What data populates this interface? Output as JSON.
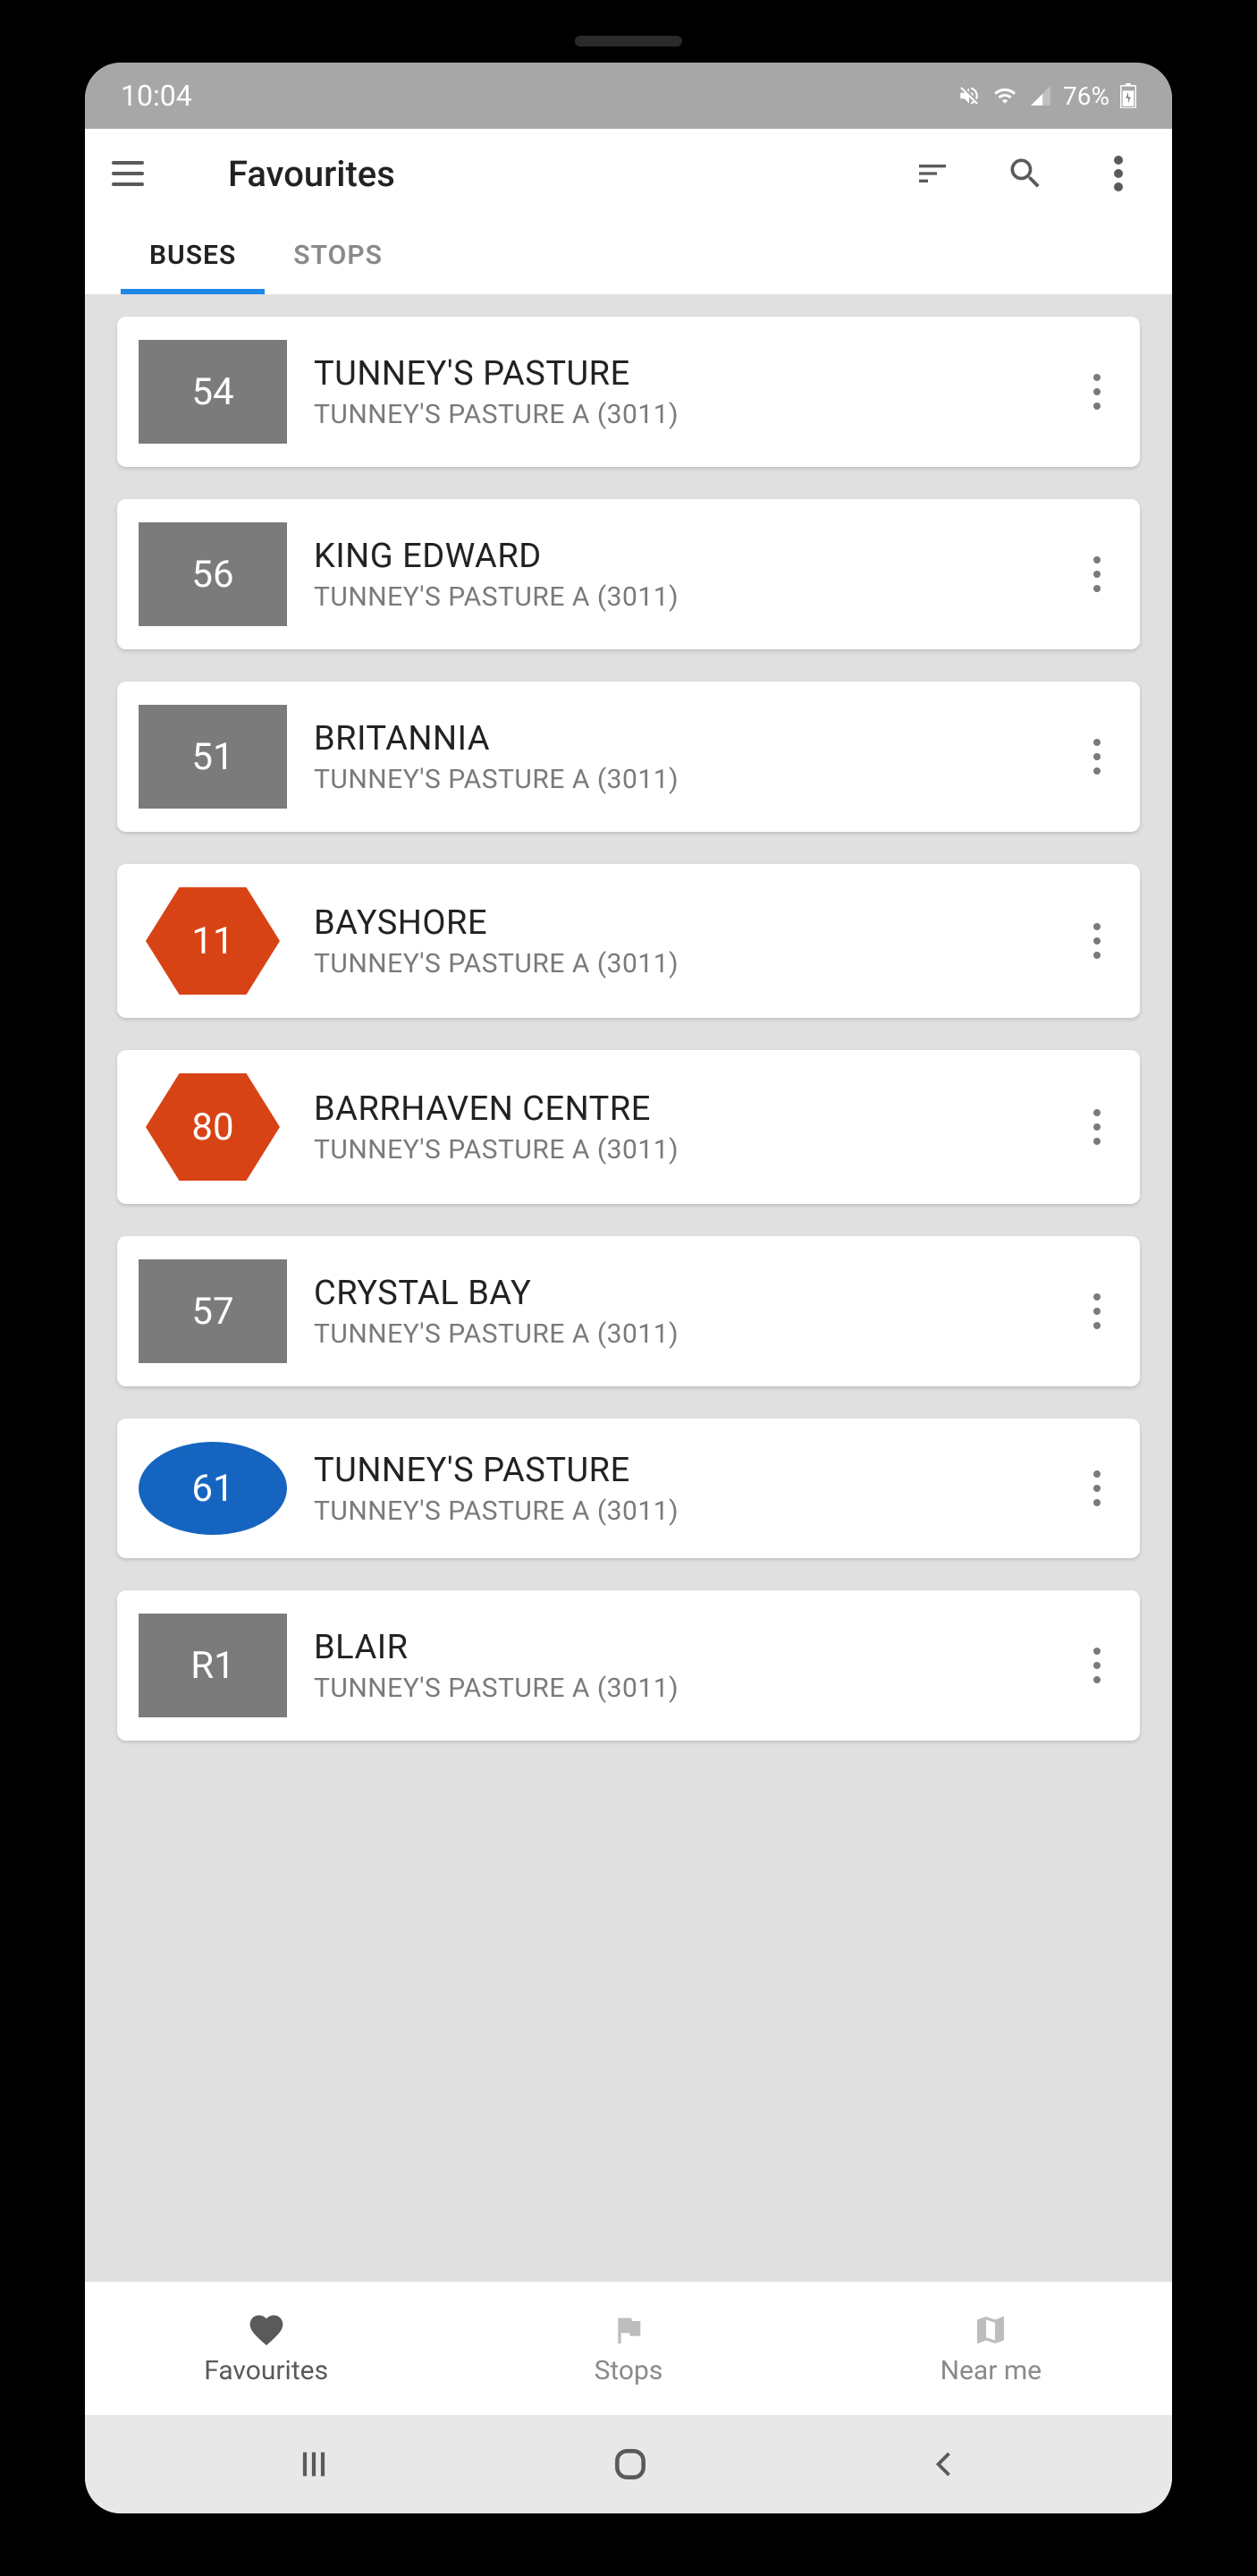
{
  "status_bar": {
    "time": "10:04",
    "battery": "76%"
  },
  "app_bar": {
    "title": "Favourites"
  },
  "tabs": {
    "buses": "BUSES",
    "stops": "STOPS"
  },
  "routes": [
    {
      "number": "54",
      "shape": "rect",
      "title": "TUNNEY'S PASTURE",
      "subtitle": "TUNNEY'S PASTURE A (3011)"
    },
    {
      "number": "56",
      "shape": "rect",
      "title": "KING EDWARD",
      "subtitle": "TUNNEY'S PASTURE A (3011)"
    },
    {
      "number": "51",
      "shape": "rect",
      "title": "BRITANNIA",
      "subtitle": "TUNNEY'S PASTURE A (3011)"
    },
    {
      "number": "11",
      "shape": "hex",
      "title": "BAYSHORE",
      "subtitle": "TUNNEY'S PASTURE A (3011)"
    },
    {
      "number": "80",
      "shape": "hex",
      "title": "BARRHAVEN CENTRE",
      "subtitle": "TUNNEY'S PASTURE A (3011)"
    },
    {
      "number": "57",
      "shape": "rect",
      "title": "CRYSTAL BAY",
      "subtitle": "TUNNEY'S PASTURE A (3011)"
    },
    {
      "number": "61",
      "shape": "ellipse",
      "title": "TUNNEY'S PASTURE",
      "subtitle": "TUNNEY'S PASTURE A (3011)"
    },
    {
      "number": "R1",
      "shape": "rect",
      "title": "BLAIR",
      "subtitle": "TUNNEY'S PASTURE A (3011)"
    }
  ],
  "bottom_nav": {
    "favourites": "Favourites",
    "stops": "Stops",
    "nearme": "Near me"
  }
}
